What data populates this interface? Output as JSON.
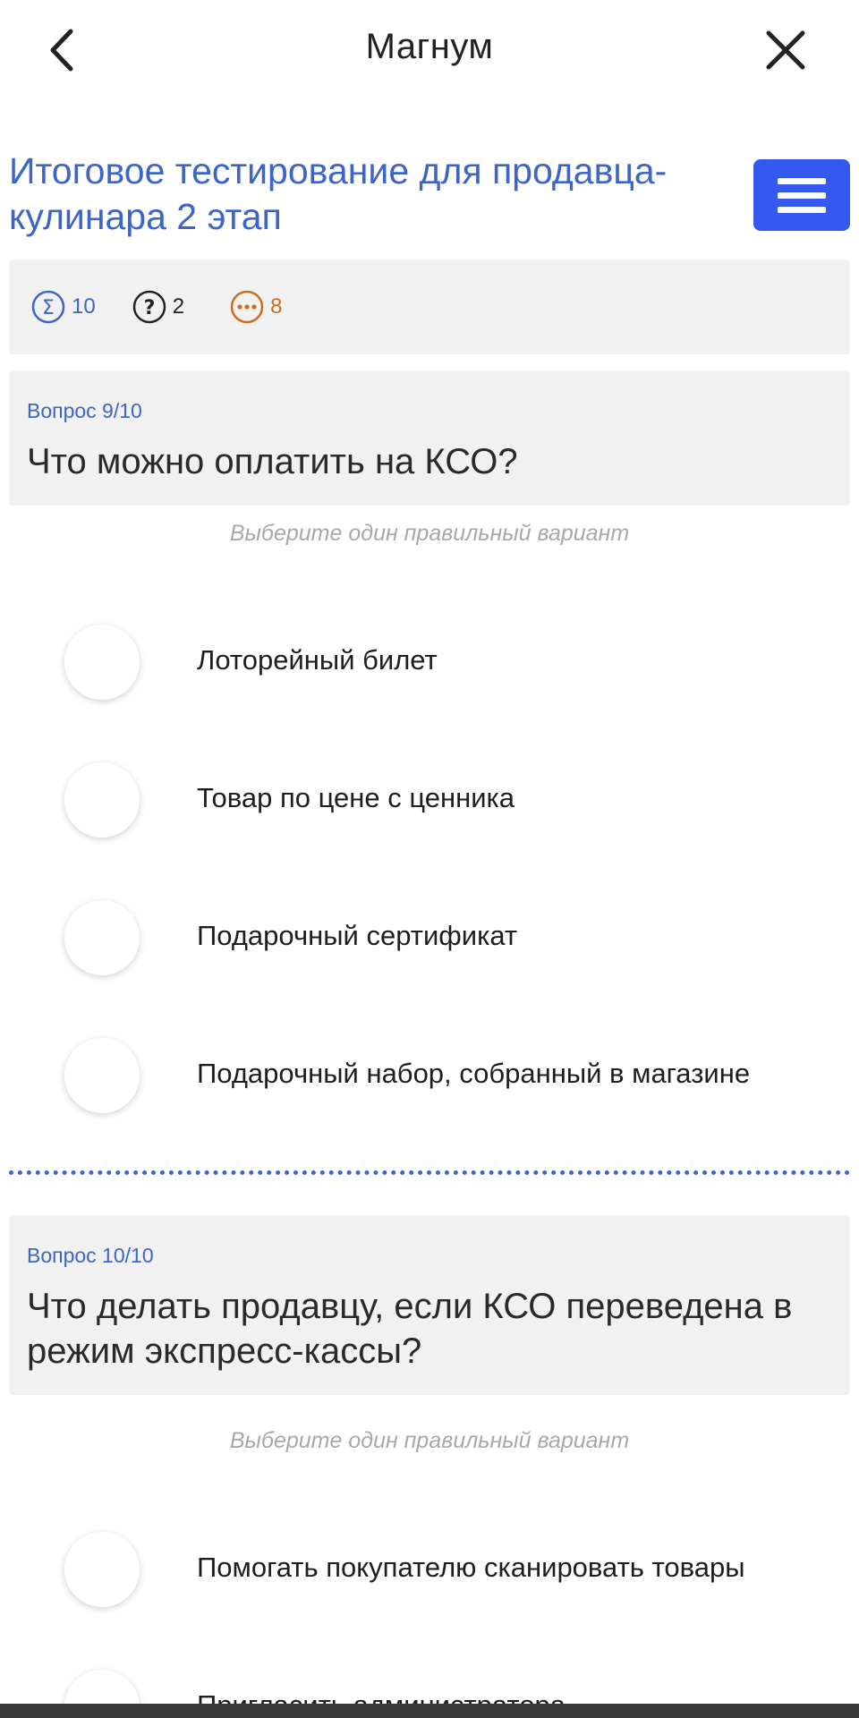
{
  "header": {
    "title": "Магнум",
    "back_icon": "chevron-left-icon",
    "close_icon": "close-icon"
  },
  "course": {
    "title": "Итоговое тестирование для продавца-кулинара 2 этап",
    "menu_icon": "hamburger-menu-icon"
  },
  "stats": {
    "total": "10",
    "unanswered": "2",
    "remaining": "8"
  },
  "questions": [
    {
      "number": "Вопрос 9/10",
      "text": "Что можно оплатить на КСО?",
      "hint": "Выберите один правильный вариант",
      "options": [
        "Лоторейный билет",
        "Товар по цене с ценника",
        "Подарочный сертификат",
        "Подарочный набор, собранный в магазине"
      ]
    },
    {
      "number": "Вопрос 10/10",
      "text": "Что делать продавцу, если КСО переведена в режим экспресс-кассы?",
      "hint": "Выберите один правильный вариант",
      "options": [
        "Помогать покупателю сканировать товары",
        "Пригласить администратора"
      ]
    }
  ],
  "colors": {
    "accent": "#3d64c8",
    "menu_button": "#3458f0",
    "remaining": "#cc6d1f",
    "panel": "#f1f1f1"
  }
}
